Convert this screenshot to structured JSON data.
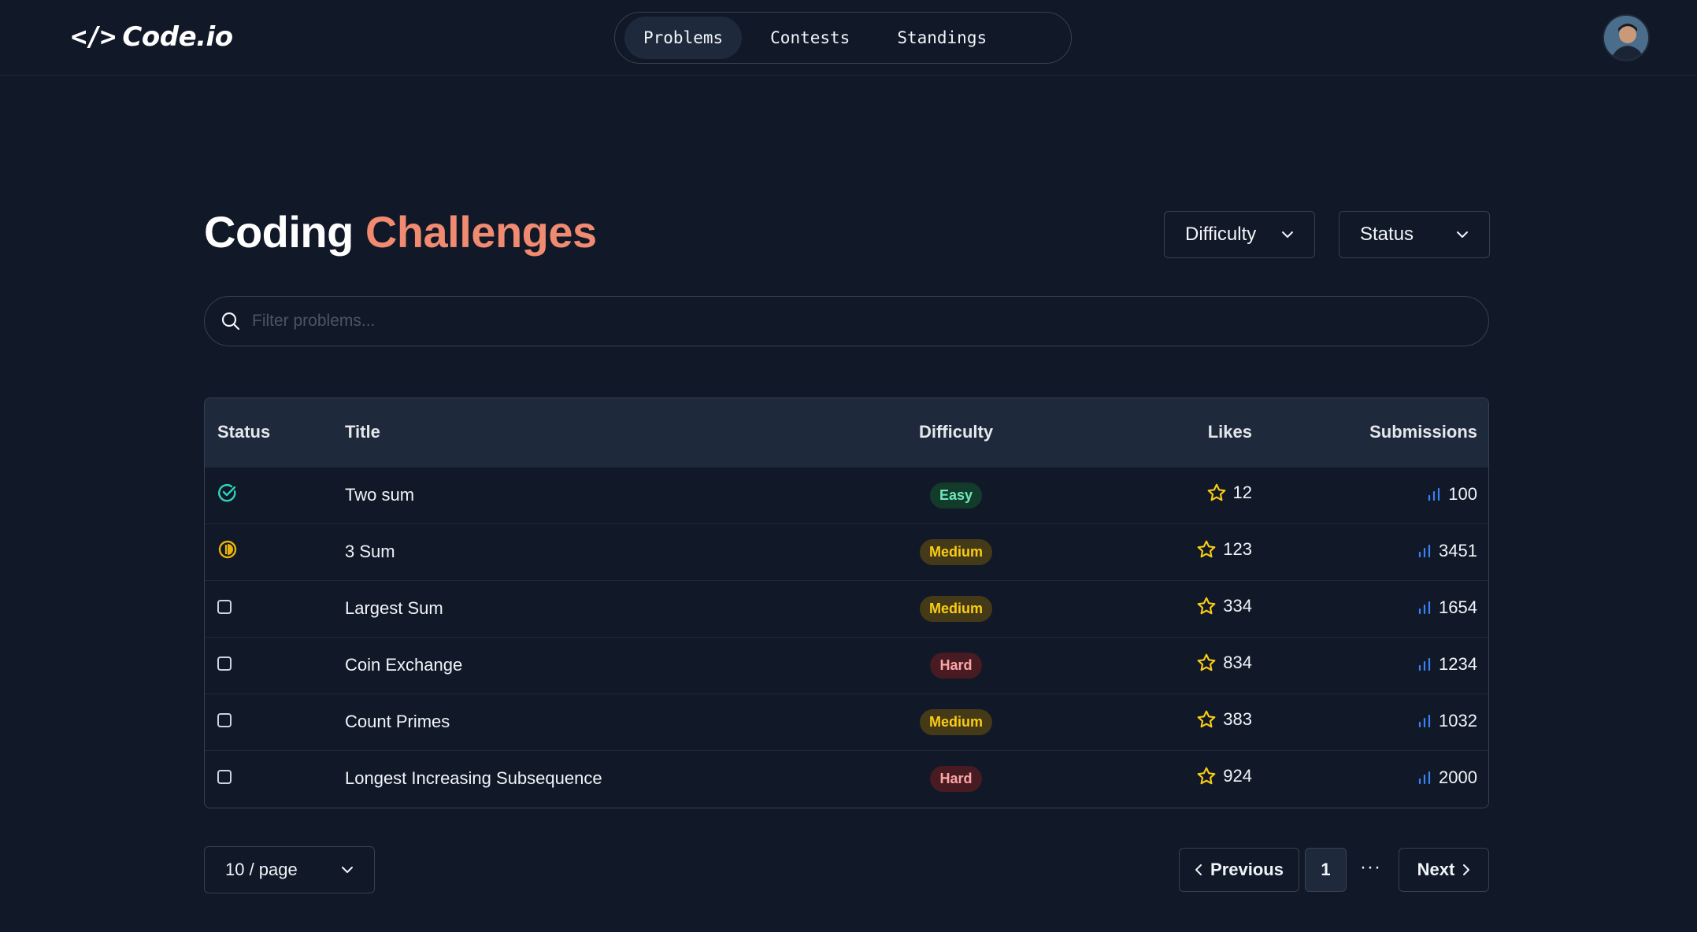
{
  "app": {
    "logo_glyph": "</>",
    "logo_text": "Code.io"
  },
  "nav": {
    "items": [
      {
        "label": "Problems",
        "active": true
      },
      {
        "label": "Contests",
        "active": false
      },
      {
        "label": "Standings",
        "active": false
      }
    ]
  },
  "header": {
    "avatar_icon": "user-avatar"
  },
  "page": {
    "title_main": "Coding",
    "title_accent": "Challenges",
    "accent_color": "#f08a70"
  },
  "filters": {
    "difficulty_label": "Difficulty",
    "status_label": "Status"
  },
  "search": {
    "placeholder": "Filter problems..."
  },
  "table": {
    "headers": {
      "status": "Status",
      "title": "Title",
      "difficulty": "Difficulty",
      "likes": "Likes",
      "submissions": "Submissions"
    },
    "rows": [
      {
        "status": "solved",
        "title": "Two sum",
        "difficulty": "Easy",
        "likes": "12",
        "submissions": "100"
      },
      {
        "status": "attempted",
        "title": "3 Sum",
        "difficulty": "Medium",
        "likes": "123",
        "submissions": "3451"
      },
      {
        "status": "todo",
        "title": "Largest Sum",
        "difficulty": "Medium",
        "likes": "334",
        "submissions": "1654"
      },
      {
        "status": "todo",
        "title": "Coin Exchange",
        "difficulty": "Hard",
        "likes": "834",
        "submissions": "1234"
      },
      {
        "status": "todo",
        "title": "Count Primes",
        "difficulty": "Medium",
        "likes": "383",
        "submissions": "1032"
      },
      {
        "status": "todo",
        "title": "Longest Increasing Subsequence",
        "difficulty": "Hard",
        "likes": "924",
        "submissions": "2000"
      }
    ]
  },
  "pagination": {
    "page_size_label": "10 / page",
    "previous_label": "Previous",
    "current_page": "1",
    "ellipsis": "···",
    "next_label": "Next"
  },
  "colors": {
    "background": "#111827",
    "easy": "#6ee7b7",
    "medium": "#facc15",
    "hard": "#fca5a5",
    "solved_icon": "#2dd4bf",
    "attempted_icon": "#eab308",
    "chart_icon": "#3b82f6",
    "star_icon": "#facc15"
  }
}
